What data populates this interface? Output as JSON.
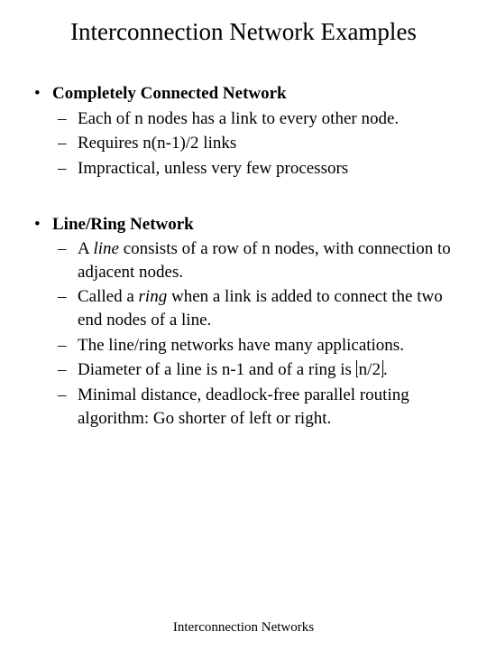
{
  "title": "Interconnection Network Examples",
  "sections": [
    {
      "heading": "Completely Connected Network",
      "items": [
        {
          "text": "Each of n nodes has a link to every other node."
        },
        {
          "text": "Requires n(n-1)/2 links"
        },
        {
          "text": "Impractical, unless very few processors"
        }
      ]
    },
    {
      "heading": "Line/Ring Network",
      "items": [
        {
          "html": "A <span class=\"italic\">line</span> consists of a row of n nodes, with connection to adjacent nodes."
        },
        {
          "html": "Called a <span class=\"italic\">ring</span> when a link is added to connect the two end nodes of a line."
        },
        {
          "text": "The line/ring networks have many applications."
        },
        {
          "html": "Diameter of a line is n-1 and of a ring is <span class=\"floor-l\"></span>n/2<span class=\"floor-r\"></span>."
        },
        {
          "text": "Minimal distance, deadlock-free parallel routing algorithm: Go shorter of left or right."
        }
      ]
    }
  ],
  "footer": "Interconnection Networks"
}
